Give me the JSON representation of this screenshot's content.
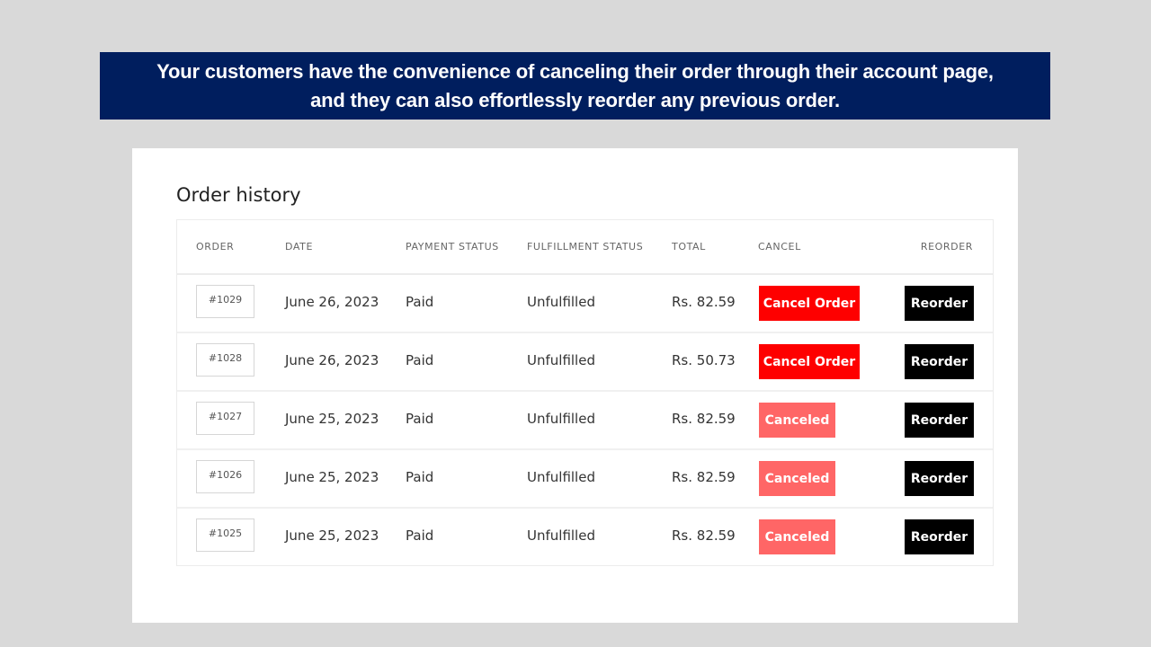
{
  "banner": {
    "line1": "Your customers have the convenience of canceling their order through their account page,",
    "line2": "and they can also effortlessly reorder any previous order."
  },
  "page": {
    "title": "Order history"
  },
  "table": {
    "headers": {
      "order": "ORDER",
      "date": "DATE",
      "payment_status": "PAYMENT STATUS",
      "fulfillment_status": "FULFILLMENT STATUS",
      "total": "TOTAL",
      "cancel": "CANCEL",
      "reorder": "REORDER"
    },
    "rows": [
      {
        "order": "#1029",
        "date": "June 26, 2023",
        "payment": "Paid",
        "fulfillment": "Unfulfilled",
        "total": "Rs. 82.59",
        "cancel_label": "Cancel Order",
        "cancel_state": "active",
        "reorder_label": "Reorder"
      },
      {
        "order": "#1028",
        "date": "June 26, 2023",
        "payment": "Paid",
        "fulfillment": "Unfulfilled",
        "total": "Rs. 50.73",
        "cancel_label": "Cancel Order",
        "cancel_state": "active",
        "reorder_label": "Reorder"
      },
      {
        "order": "#1027",
        "date": "June 25, 2023",
        "payment": "Paid",
        "fulfillment": "Unfulfilled",
        "total": "Rs. 82.59",
        "cancel_label": "Canceled",
        "cancel_state": "canceled",
        "reorder_label": "Reorder"
      },
      {
        "order": "#1026",
        "date": "June 25, 2023",
        "payment": "Paid",
        "fulfillment": "Unfulfilled",
        "total": "Rs. 82.59",
        "cancel_label": "Canceled",
        "cancel_state": "canceled",
        "reorder_label": "Reorder"
      },
      {
        "order": "#1025",
        "date": "June 25, 2023",
        "payment": "Paid",
        "fulfillment": "Unfulfilled",
        "total": "Rs. 82.59",
        "cancel_label": "Canceled",
        "cancel_state": "canceled",
        "reorder_label": "Reorder"
      }
    ]
  },
  "colors": {
    "banner_bg": "#001e5e",
    "cancel_active": "#fe0000",
    "cancel_done": "#ff6666",
    "reorder": "#000000"
  }
}
